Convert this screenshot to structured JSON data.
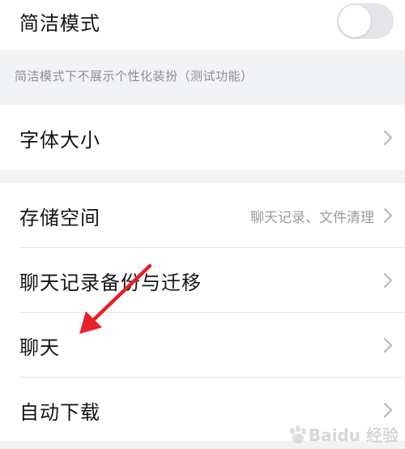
{
  "simple_mode": {
    "label": "简洁模式",
    "toggle_on": false,
    "note": "简洁模式下不展示个性化装扮（测试功能）"
  },
  "font_size": {
    "label": "字体大小"
  },
  "settings": [
    {
      "label": "存储空间",
      "value": "聊天记录、文件清理"
    },
    {
      "label": "聊天记录备份与迁移"
    },
    {
      "label": "聊天"
    },
    {
      "label": "自动下载"
    }
  ],
  "annotation": {
    "arrow_color": "#e8202a",
    "points_to": "聊天"
  },
  "watermark": {
    "text": "Baidu 经验"
  },
  "colors": {
    "background": "#f2f3f5",
    "card": "#ffffff",
    "secondary_text": "#9a9aa0",
    "toggle_off": "#e4e5e9"
  }
}
